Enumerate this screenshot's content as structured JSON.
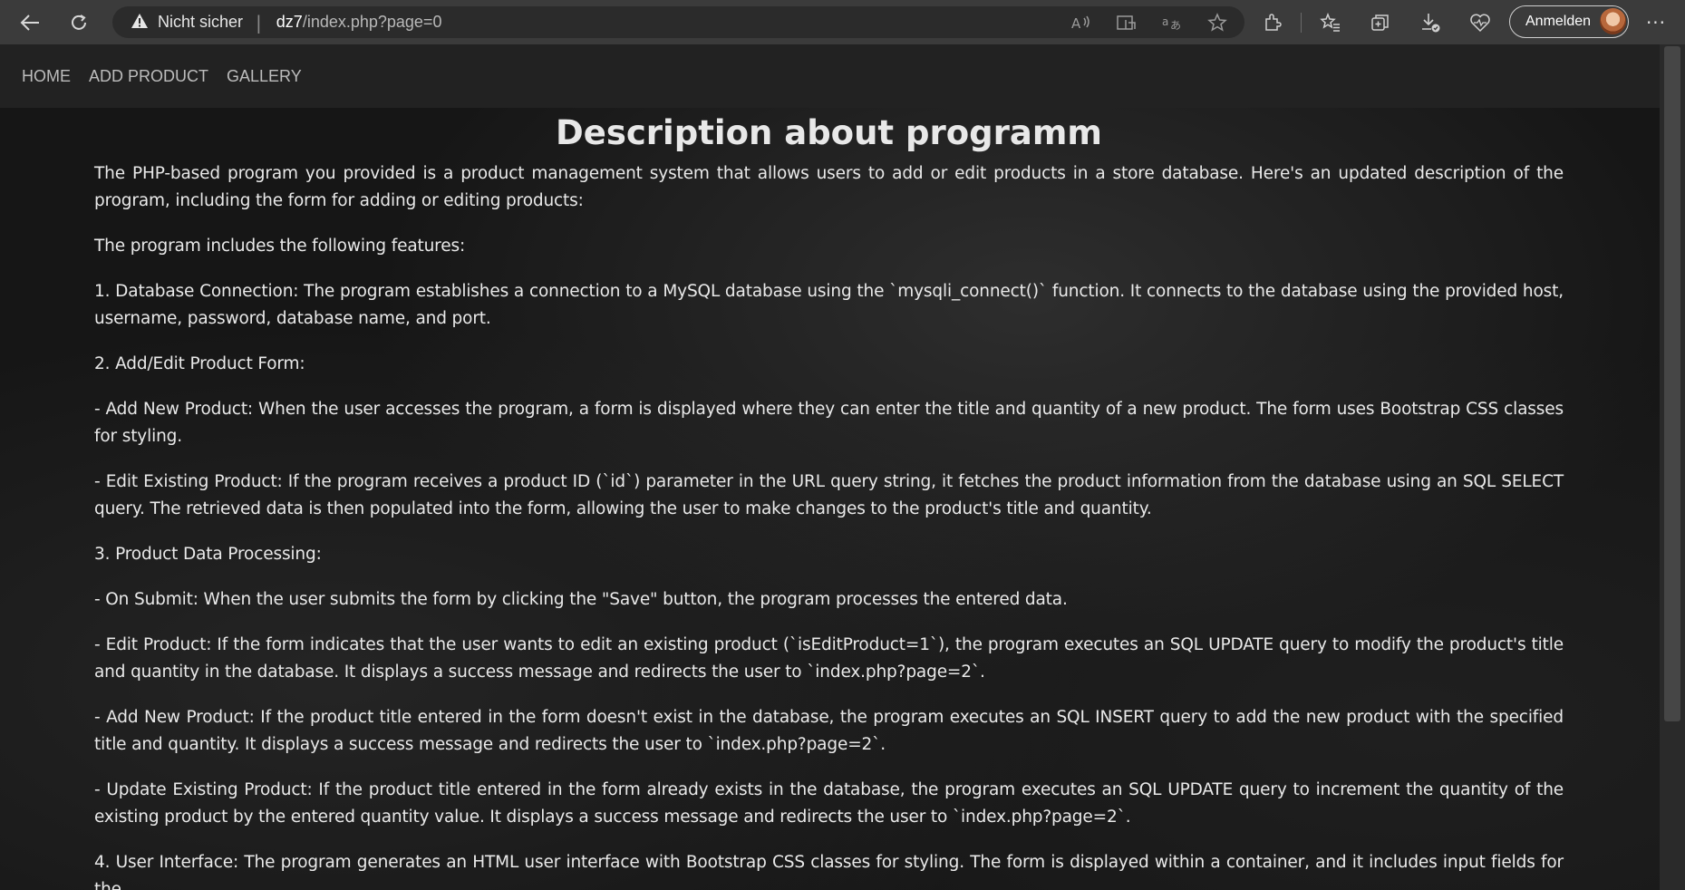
{
  "browser": {
    "security_label": "Nicht sicher",
    "url_host": "dz7",
    "url_path": "/index.php?page=0",
    "signin_label": "Anmelden",
    "more_label": "···"
  },
  "navbar": {
    "items": [
      "HOME",
      "ADD PRODUCT",
      "GALLERY"
    ]
  },
  "main": {
    "heading": "Description about programm",
    "paragraphs": [
      "The PHP-based program you provided is a product management system that allows users to add or edit products in a store database. Here's an updated description of the program, including the form for adding or editing products:",
      "The program includes the following features:",
      "1. Database Connection: The program establishes a connection to a MySQL database using the `mysqli_connect()` function. It connects to the database using the provided host, username, password, database name, and port.",
      "2. Add/Edit Product Form:",
      "- Add New Product: When the user accesses the program, a form is displayed where they can enter the title and quantity of a new product. The form uses Bootstrap CSS classes for styling.",
      "- Edit Existing Product: If the program receives a product ID (`id`) parameter in the URL query string, it fetches the product information from the database using an SQL SELECT query. The retrieved data is then populated into the form, allowing the user to make changes to the product's title and quantity.",
      "3. Product Data Processing:",
      "- On Submit: When the user submits the form by clicking the \"Save\" button, the program processes the entered data.",
      "- Edit Product: If the form indicates that the user wants to edit an existing product (`isEditProduct=1`), the program executes an SQL UPDATE query to modify the product's title and quantity in the database. It displays a success message and redirects the user to `index.php?page=2`.",
      "- Add New Product: If the product title entered in the form doesn't exist in the database, the program executes an SQL INSERT query to add the new product with the specified title and quantity. It displays a success message and redirects the user to `index.php?page=2`.",
      "- Update Existing Product: If the product title entered in the form already exists in the database, the program executes an SQL UPDATE query to increment the quantity of the existing product by the entered quantity value. It displays a success message and redirects the user to `index.php?page=2`.",
      "4. User Interface: The program generates an HTML user interface with Bootstrap CSS classes for styling. The form is displayed within a container, and it includes input fields for the"
    ]
  }
}
